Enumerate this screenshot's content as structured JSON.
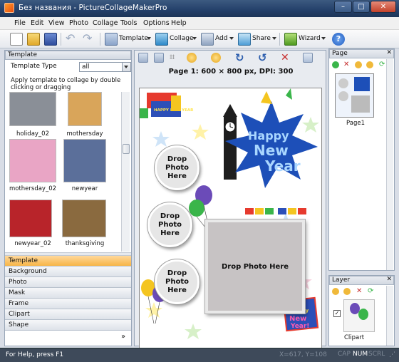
{
  "window": {
    "title": "Без названия - PictureCollageMakerPro",
    "controls": [
      "minimize",
      "maximize",
      "close"
    ]
  },
  "menu": [
    "File",
    "Edit",
    "View",
    "Photo",
    "Collage",
    "Tools",
    "Options",
    "Help"
  ],
  "toolbar": {
    "template_label": "Template",
    "collage_label": "Collage",
    "add_label": "Add",
    "share_label": "Share",
    "wizard_label": "Wizard"
  },
  "left_panel": {
    "header": "Template",
    "template_type_label": "Template Type",
    "template_type_value": "all",
    "hint": "Apply template to collage by double clicking or dragging",
    "templates": [
      {
        "label": "holiday_02",
        "color": "#8a8f97"
      },
      {
        "label": "mothersday",
        "color": "#d9a55a"
      },
      {
        "label": "mothersday_02",
        "color": "#e9a5c5"
      },
      {
        "label": "newyear",
        "color": "#5b6f9a"
      },
      {
        "label": "newyear_02",
        "color": "#b8242a"
      },
      {
        "label": "thanksgiving",
        "color": "#8a6a3f"
      }
    ],
    "nav": [
      "Template",
      "Background",
      "Photo",
      "Mask",
      "Frame",
      "Clipart",
      "Shape"
    ],
    "nav_active": "Template"
  },
  "canvas": {
    "caption": "Page 1: 600 × 800 px, DPI: 300",
    "placeholder": "Drop Photo Here",
    "banner_text": "HAPPY NEW YEAR"
  },
  "page_panel": {
    "header": "Page",
    "page_label": "Page1"
  },
  "layer_panel": {
    "header": "Layer",
    "item_label": "Clipart"
  },
  "status": {
    "help": "For Help, press F1",
    "coords": "X=617, Y=108",
    "indicators": [
      "CAP",
      "NUM",
      "SCRL"
    ]
  },
  "colors": {
    "title_bar": "#24406a",
    "status_bar": "#3e4a5a",
    "accent": "#f7b547"
  }
}
